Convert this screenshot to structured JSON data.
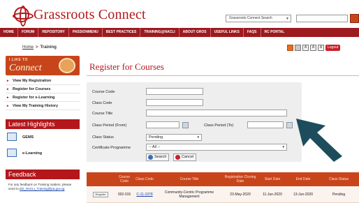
{
  "header": {
    "logo_text": "Grassroots Connect",
    "search_scope": "Grassroots Connect Search",
    "search_value": ""
  },
  "nav": {
    "items": [
      "HOME",
      "FORUM",
      "REPOSITORY",
      "PASSIONMENU",
      "BEST PRACTICES",
      "TRAINING@NACLI",
      "ABOUT GROS",
      "USEFUL LINKS",
      "FAQS",
      "RC PORTAL"
    ]
  },
  "breadcrumb": {
    "home": "Home",
    "separator": ">",
    "current": "Training"
  },
  "banner": {
    "small": "I LIKE TO",
    "big": "Connect"
  },
  "sidebar": {
    "items": [
      "View My Registration",
      "Register for Courses",
      "Register for e-Learning",
      "View My Training History"
    ]
  },
  "highlights": {
    "heading": "Latest Highlights",
    "items": [
      "GEMS",
      "e-Learning"
    ]
  },
  "feedback": {
    "heading": "Feedback",
    "text": "For any feedback on Training matters, please send to",
    "link": "ED_NACLI_Training@pa.gov.sg"
  },
  "toolbar": {
    "logout_label": "Logout",
    "font_small": "A",
    "font_medium": "A",
    "font_large": "A"
  },
  "page": {
    "title": "Register for Courses"
  },
  "form": {
    "course_code_label": "Course Code",
    "class_code_label": "Class Code",
    "course_title_label": "Course Title",
    "class_period_from_label": "Class Period (From)",
    "class_period_to_label": "Class Period (To)",
    "class_status_label": "Class Status",
    "class_status_value": "Pending",
    "cert_programme_label": "Certificate Programme",
    "cert_programme_value": "-- All --",
    "search_label": "Search",
    "cancel_label": "Cancel"
  },
  "table": {
    "headers": [
      "",
      "Course Code",
      "Class Code",
      "Course Title",
      "Registration Closing Date",
      "Start Date",
      "End Date",
      "Class Status"
    ],
    "rows": [
      [
        "Register",
        "002-015",
        "C-11-1978",
        "Community-Centric Programme Management",
        "23-May-2020",
        "11-Jun-2020",
        "13-Jun-2020",
        "Pending"
      ]
    ]
  },
  "colors": {
    "brand": "#b3171c",
    "nav": "#9d1a1f",
    "table_header": "#c8451c",
    "arrow": "#1d4d5c"
  }
}
